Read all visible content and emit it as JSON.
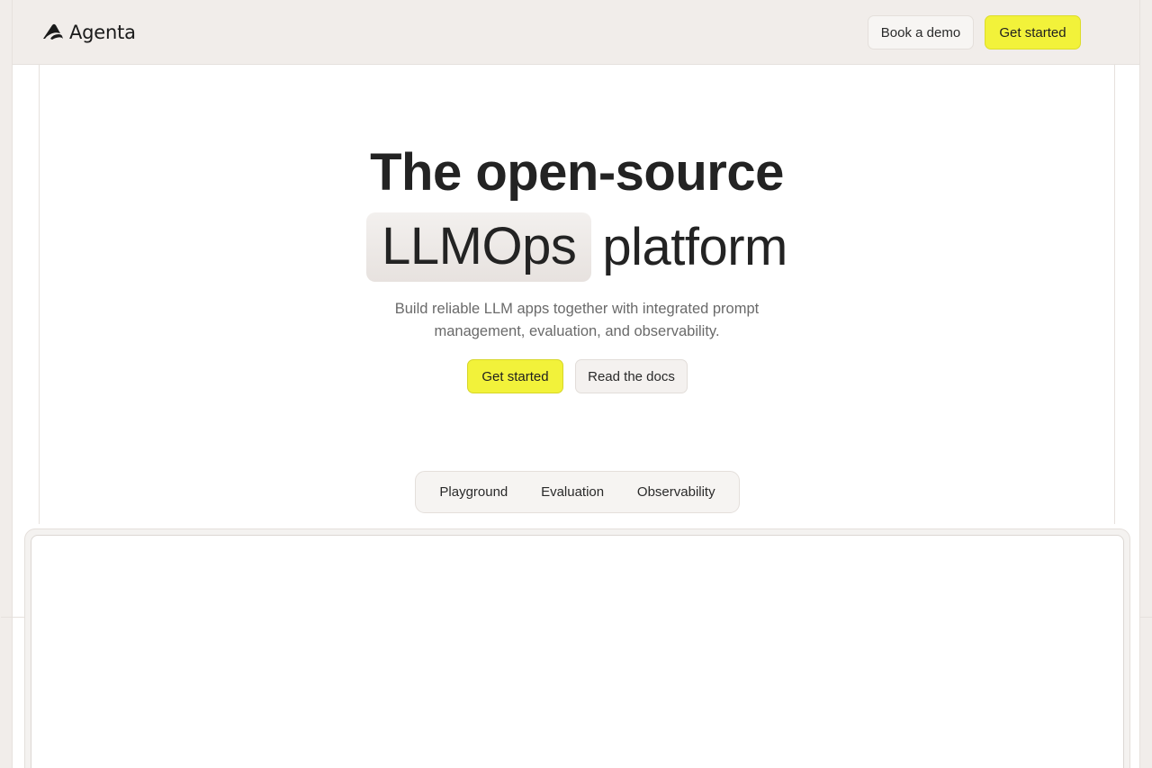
{
  "header": {
    "logo_text": "Agenta",
    "book_demo_label": "Book a demo",
    "get_started_label": "Get started"
  },
  "hero": {
    "title_line1": "The open-source",
    "title_highlight": "LLMOps",
    "title_rest": "platform",
    "subtitle": "Build reliable LLM apps together with integrated prompt management, evaluation, and observability.",
    "cta_primary": "Get started",
    "cta_secondary": "Read the docs"
  },
  "tabs": [
    {
      "label": "Playground"
    },
    {
      "label": "Evaluation"
    },
    {
      "label": "Observability"
    }
  ],
  "colors": {
    "accent": "#f2f23a",
    "background": "#f1edea"
  }
}
